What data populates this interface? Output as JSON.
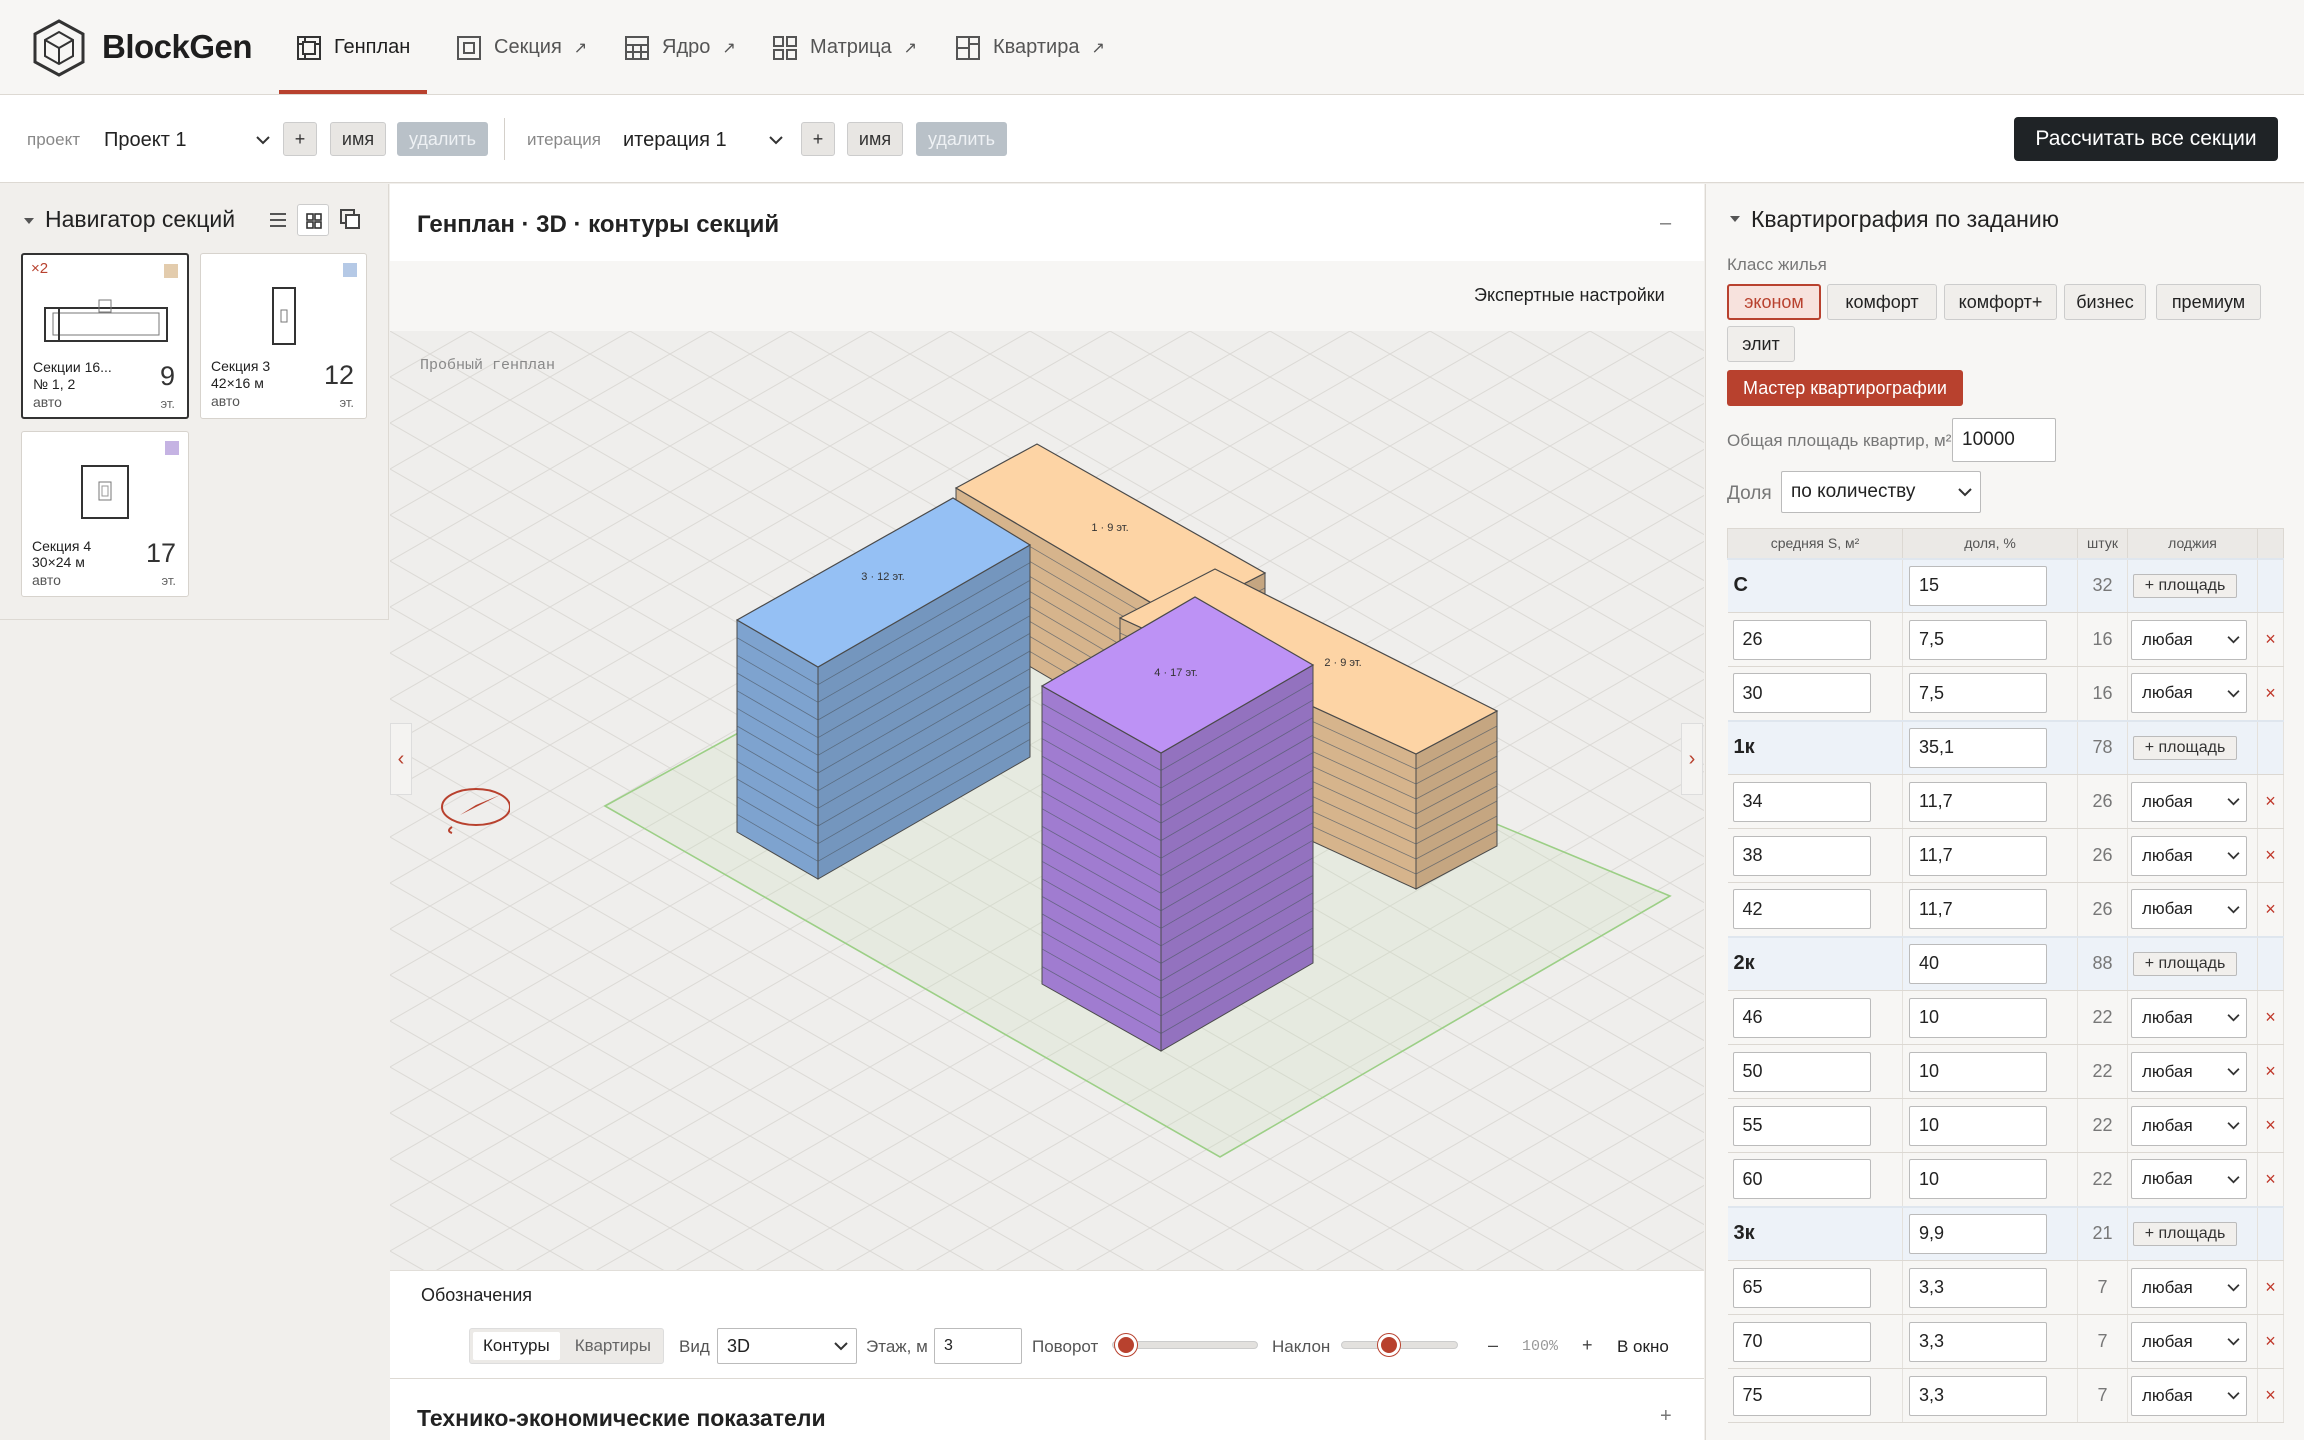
{
  "app": {
    "name": "BlockGen"
  },
  "nav": {
    "tabs": [
      {
        "label": "Генплан",
        "icon": "genplan-icon",
        "external": false,
        "active": true
      },
      {
        "label": "Секция",
        "icon": "section-icon",
        "external": true
      },
      {
        "label": "Ядро",
        "icon": "core-icon",
        "external": true
      },
      {
        "label": "Матрица",
        "icon": "matrix-icon",
        "external": true
      },
      {
        "label": "Квартира",
        "icon": "apartment-icon",
        "external": true
      }
    ],
    "external_mark": "↗"
  },
  "project": {
    "label": "проект",
    "value": "Проект 1",
    "add": "+",
    "rename": "имя",
    "delete": "удалить"
  },
  "iteration": {
    "label": "итерация",
    "value": "итерация 1",
    "add": "+",
    "rename": "имя",
    "delete": "удалить"
  },
  "calc_all": "Рассчитать все секции",
  "navigator": {
    "title": "Навигатор секций",
    "cards": [
      {
        "badge": "×2",
        "name1": "Секции 16...",
        "name2": "№ 1, 2",
        "mode": "авто",
        "floors": "9",
        "floors_unit": "эт.",
        "color": "#e3ccad"
      },
      {
        "name1": "Секция 3",
        "name2": "42×16 м",
        "mode": "авто",
        "floors": "12",
        "floors_unit": "эт.",
        "color": "#b5c9e6"
      },
      {
        "name1": "Секция 4",
        "name2": "30×24 м",
        "mode": "авто",
        "floors": "17",
        "floors_unit": "эт.",
        "color": "#c5b3e3"
      }
    ]
  },
  "genplan": {
    "title": "Генплан · 3D · контуры секций",
    "collapse": "–",
    "expert": "Экспертные настройки",
    "trial_label": "Пробный генплан",
    "buildings": [
      {
        "label": "1 · 9 эт.",
        "floors": 9,
        "color": "#d6b48c"
      },
      {
        "label": "2 · 9 эт.",
        "floors": 9,
        "color": "#d6b48c"
      },
      {
        "label": "3 · 12 эт.",
        "floors": 12,
        "color": "#7ea3cf"
      },
      {
        "label": "4 · 17 эт.",
        "floors": 17,
        "color": "#a07cd0"
      }
    ]
  },
  "legend": {
    "title": "Обозначения",
    "seg": [
      "Контуры",
      "Квартиры"
    ],
    "view_label": "Вид",
    "view_value": "3D",
    "floor_label": "Этаж, м",
    "floor_value": "3",
    "rotate_label": "Поворот",
    "tilt_label": "Наклон",
    "zoom_minus": "–",
    "zoom_value": "100%",
    "zoom_plus": "+",
    "window": "В окно"
  },
  "tep": {
    "title": "Технико-экономические показатели",
    "expand": "+"
  },
  "kv": {
    "title": "Квартирография по заданию",
    "class_label": "Класс жилья",
    "classes": [
      "эконом",
      "комфорт",
      "комфорт+",
      "бизнес",
      "премиум",
      "элит"
    ],
    "active_class": "эконом",
    "master": "Мастер квартирографии",
    "total_label": "Общая площадь квартир, м²",
    "total_value": "10000",
    "share_label": "Доля",
    "share_value": "по количеству",
    "columns": [
      "средняя S, м²",
      "доля, %",
      "штук",
      "лоджия"
    ],
    "add_area": "+ площадь",
    "loggia_value": "любая",
    "del": "×",
    "groups": [
      {
        "name": "С",
        "share": "15",
        "count": "32",
        "rows": [
          {
            "area": "26",
            "share": "7,5",
            "count": "16"
          },
          {
            "area": "30",
            "share": "7,5",
            "count": "16"
          }
        ]
      },
      {
        "name": "1к",
        "share": "35,1",
        "count": "78",
        "rows": [
          {
            "area": "34",
            "share": "11,7",
            "count": "26"
          },
          {
            "area": "38",
            "share": "11,7",
            "count": "26"
          },
          {
            "area": "42",
            "share": "11,7",
            "count": "26"
          }
        ]
      },
      {
        "name": "2к",
        "share": "40",
        "count": "88",
        "rows": [
          {
            "area": "46",
            "share": "10",
            "count": "22"
          },
          {
            "area": "50",
            "share": "10",
            "count": "22"
          },
          {
            "area": "55",
            "share": "10",
            "count": "22"
          },
          {
            "area": "60",
            "share": "10",
            "count": "22"
          }
        ]
      },
      {
        "name": "3к",
        "share": "9,9",
        "count": "21",
        "rows": [
          {
            "area": "65",
            "share": "3,3",
            "count": "7"
          },
          {
            "area": "70",
            "share": "3,3",
            "count": "7"
          },
          {
            "area": "75",
            "share": "3,3",
            "count": "7"
          }
        ]
      }
    ]
  }
}
